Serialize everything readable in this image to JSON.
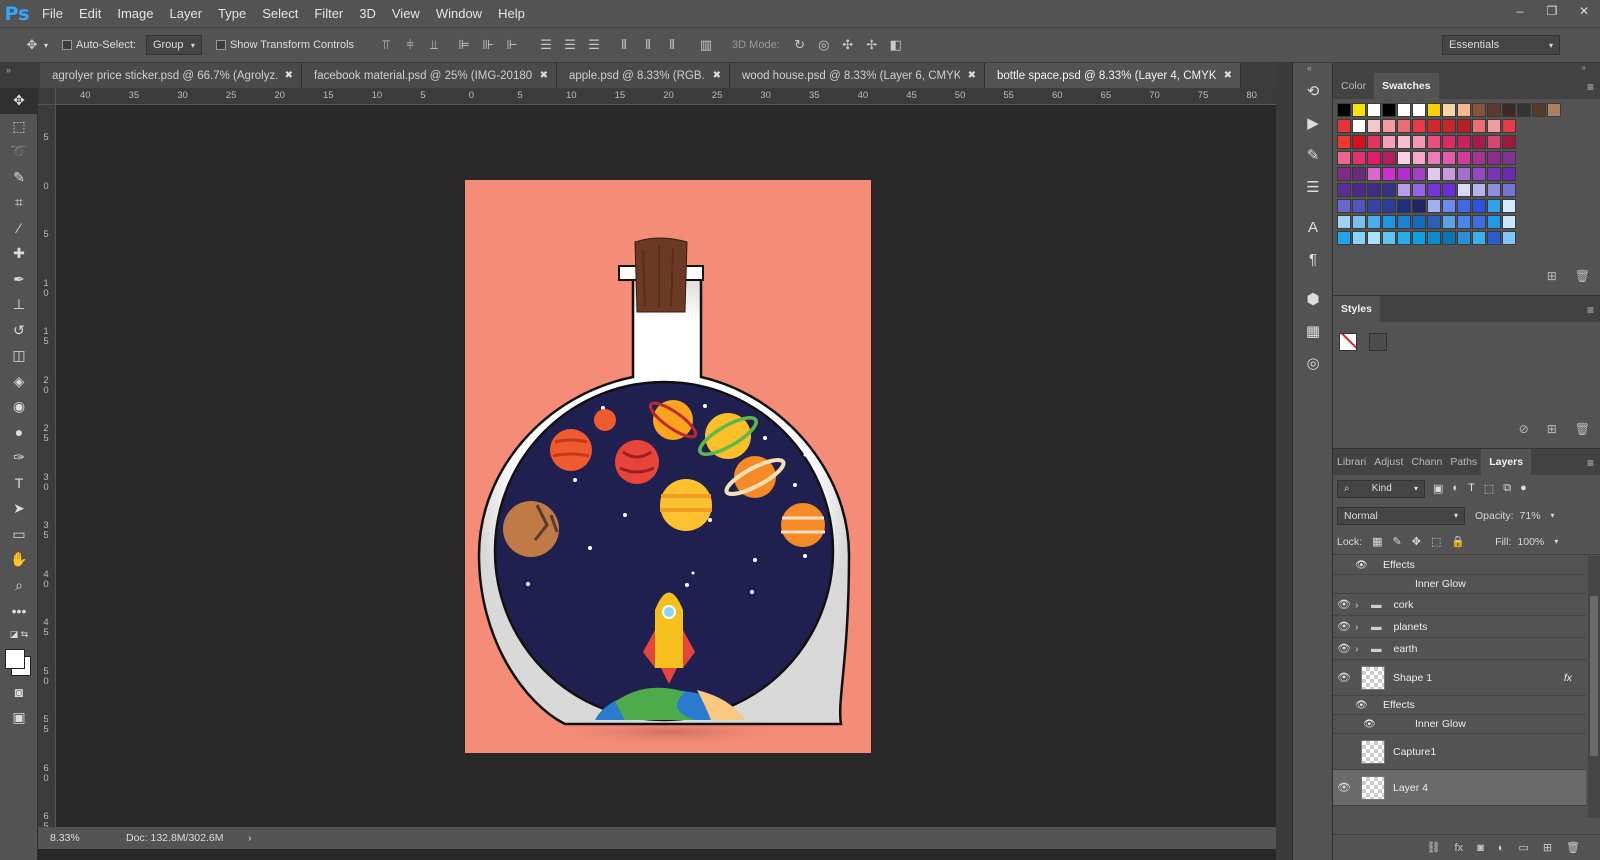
{
  "app": {
    "logo": "Ps"
  },
  "menu": [
    "File",
    "Edit",
    "Image",
    "Layer",
    "Type",
    "Select",
    "Filter",
    "3D",
    "View",
    "Window",
    "Help"
  ],
  "window_controls": {
    "minimize": "–",
    "restore": "❐",
    "close": "✕"
  },
  "options": {
    "auto_select_label": "Auto-Select:",
    "auto_select_value": "Group",
    "transform_label": "Show Transform Controls",
    "mode_3d": "3D Mode:",
    "workspace": "Essentials"
  },
  "doc_tabs": [
    {
      "label": "agrolyer price sticker.psd @ 66.7% (Agrolyz...",
      "active": false
    },
    {
      "label": "facebook material.psd @ 25% (IMG-201808...",
      "active": false
    },
    {
      "label": "apple.psd @ 8.33% (RGB...",
      "active": false
    },
    {
      "label": "wood house.psd @ 8.33% (Layer 6, CMYK...",
      "active": false
    },
    {
      "label": "bottle space.psd @ 8.33% (Layer 4, CMYK/8)",
      "active": true
    }
  ],
  "ruler_top": [
    "40",
    "35",
    "30",
    "25",
    "20",
    "15",
    "10",
    "5",
    "0",
    "5",
    "10",
    "15",
    "20",
    "25",
    "30",
    "35",
    "40",
    "45",
    "50",
    "55",
    "60",
    "65",
    "70",
    "75",
    "80"
  ],
  "ruler_left": [
    "5",
    "0",
    "5",
    "1 0",
    "1 5",
    "2 0",
    "2 5",
    "3 0",
    "3 5",
    "4 0",
    "4 5",
    "5 0",
    "5 5",
    "6 0",
    "6 5"
  ],
  "status": {
    "zoom": "8.33%",
    "doc": "Doc: 132.8M/302.6M",
    "arrow": "›"
  },
  "color_panel": {
    "tabs": [
      "Color",
      "Swatches"
    ],
    "active": "Swatches"
  },
  "swatch_colors": [
    [
      "#000000",
      "#f5e400",
      "#ffffff",
      "#000000",
      "#ffffff",
      "#ffffff",
      "#f7d100",
      "#f8d5a8",
      "#f4b78c",
      "#8c4f3c",
      "#5a3a2c",
      "#3a2a22",
      "#333333",
      "#56392a",
      "#a98060"
    ],
    [
      "#e8333a",
      "#ffffff",
      "#f7c6c8",
      "#f29ba0",
      "#ee6d73",
      "#e83a44",
      "#d6262e",
      "#c9242a",
      "#b51e25",
      "#ee6d73",
      "#f29ba0",
      "#e83a44"
    ],
    [
      "#f1382f",
      "#d81017",
      "#e4335c",
      "#f4a1b7",
      "#f6bfce",
      "#f397b5",
      "#e94e7c",
      "#da2b66",
      "#c8215c",
      "#a61a4d",
      "#d94477",
      "#9b1a3a"
    ],
    [
      "#ef6690",
      "#e4306f",
      "#e8196b",
      "#b61d61",
      "#fbd1e4",
      "#f5a7ce",
      "#ee7cb9",
      "#e05ca8",
      "#d13c9b",
      "#a53192",
      "#8c2d8c",
      "#7c3490"
    ],
    [
      "#7e2c86",
      "#6a2a7f",
      "#dd65cf",
      "#cd2fd0",
      "#b52ccf",
      "#a33ec9",
      "#e1c9ec",
      "#c79ade",
      "#a86ed1",
      "#9547c7",
      "#7a33b7",
      "#6e2bb1"
    ],
    [
      "#5a2d96",
      "#4a2a8c",
      "#3d2b87",
      "#362f87",
      "#b69dec",
      "#9763e6",
      "#7436db",
      "#6b2dd5",
      "#dad7f3",
      "#b5b3ea",
      "#8d8fdd",
      "#7474d3"
    ],
    [
      "#6868cc",
      "#5154bf",
      "#3443a7",
      "#2c3d99",
      "#1e2f7c",
      "#1e2466",
      "#a0b0f0",
      "#6b8af0",
      "#3e6ae8",
      "#2a52e3",
      "#2ea2e9",
      "#d3eafa"
    ],
    [
      "#9fd1f3",
      "#76bfef",
      "#4aaced",
      "#1d95e3",
      "#1b81d4",
      "#146cc2",
      "#2a5fb8",
      "#5aa3e8",
      "#4a86ea",
      "#3b6de2",
      "#1f99e8",
      "#cae6fa"
    ],
    [
      "#1da5ea",
      "#88d4f6",
      "#abe1f9",
      "#5cc6f3",
      "#22b1ee",
      "#0aa0e3",
      "#0c8bd0",
      "#0b73b8",
      "#2d8fd8",
      "#3bb0f0",
      "#2a5dd0",
      "#80c8f3"
    ]
  ],
  "styles_panel": {
    "tab": "Styles"
  },
  "layers_panel": {
    "tabs": [
      "Librari",
      "Adjust",
      "Chann",
      "Paths",
      "Layers"
    ],
    "active": "Layers",
    "kind": "Kind",
    "blend": "Normal",
    "opacity_label": "Opacity:",
    "opacity": "71%",
    "lock_label": "Lock:",
    "fill_label": "Fill:",
    "fill": "100%",
    "rows": [
      {
        "name": "Effects",
        "type": "effects-head",
        "visible": true
      },
      {
        "name": "Inner Glow",
        "type": "effect",
        "visible": false
      },
      {
        "name": "cork",
        "type": "group",
        "visible": true
      },
      {
        "name": "planets",
        "type": "group",
        "visible": true
      },
      {
        "name": "earth",
        "type": "group",
        "visible": true
      },
      {
        "name": "Shape 1",
        "type": "shape",
        "visible": true,
        "fx": "fx"
      },
      {
        "name": "Effects",
        "type": "effects-head",
        "visible": true
      },
      {
        "name": "Inner Glow",
        "type": "effect",
        "visible": true
      },
      {
        "name": "Capture1",
        "type": "image",
        "visible": false
      },
      {
        "name": "Layer 4",
        "type": "layer",
        "visible": true,
        "selected": true
      }
    ]
  },
  "colors": {
    "ui_dark": "#282828",
    "ui_panel": "#535353",
    "accent": "#31a8ff",
    "artboard": "#f48c78",
    "space": "#202050"
  }
}
